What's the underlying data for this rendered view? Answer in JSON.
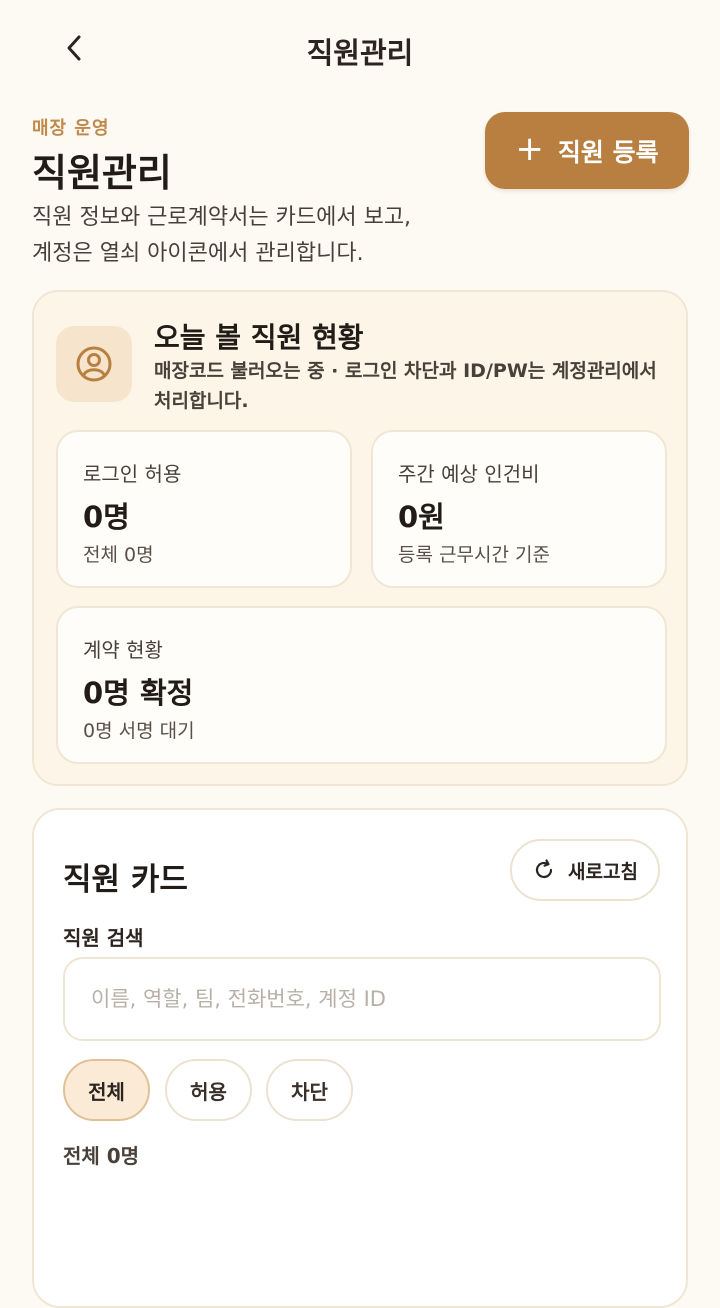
{
  "header": {
    "title": "직원관리"
  },
  "intro": {
    "eyebrow": "매장 운영",
    "title": "직원관리",
    "description": "직원 정보와 근로계약서는 카드에서 보고,\n계정은 열쇠 아이콘에서 관리합니다.",
    "add_button_label": "직원 등록"
  },
  "summary": {
    "icon": "user-circle-icon",
    "title": "오늘 볼 직원 현황",
    "subtitle": "매장코드 불러오는 중 · 로그인 차단과 ID/PW는 계정관리에서 처리합니다.",
    "stats": [
      {
        "label": "로그인 허용",
        "value": "0명",
        "sub": "전체 0명"
      },
      {
        "label": "주간 예상 인건비",
        "value": "0원",
        "sub": "등록 근무시간 기준"
      },
      {
        "label": "계약 현황",
        "value": "0명 확정",
        "sub": "0명 서명 대기"
      }
    ]
  },
  "employee_cards": {
    "title": "직원 카드",
    "refresh_label": "새로고침",
    "search_label": "직원 검색",
    "search_placeholder": "이름, 역할, 팀, 전화번호, 계정 ID",
    "search_value": "",
    "filters": [
      "전체",
      "허용",
      "차단"
    ],
    "active_filter": "전체",
    "count_text": "전체 0명"
  },
  "colors": {
    "accent": "#b97f41",
    "eyebrow": "#c08a4a",
    "background": "#fdfaf4",
    "summary_bg": "#fdf5e8",
    "chip_active_bg": "#fbebd6"
  }
}
